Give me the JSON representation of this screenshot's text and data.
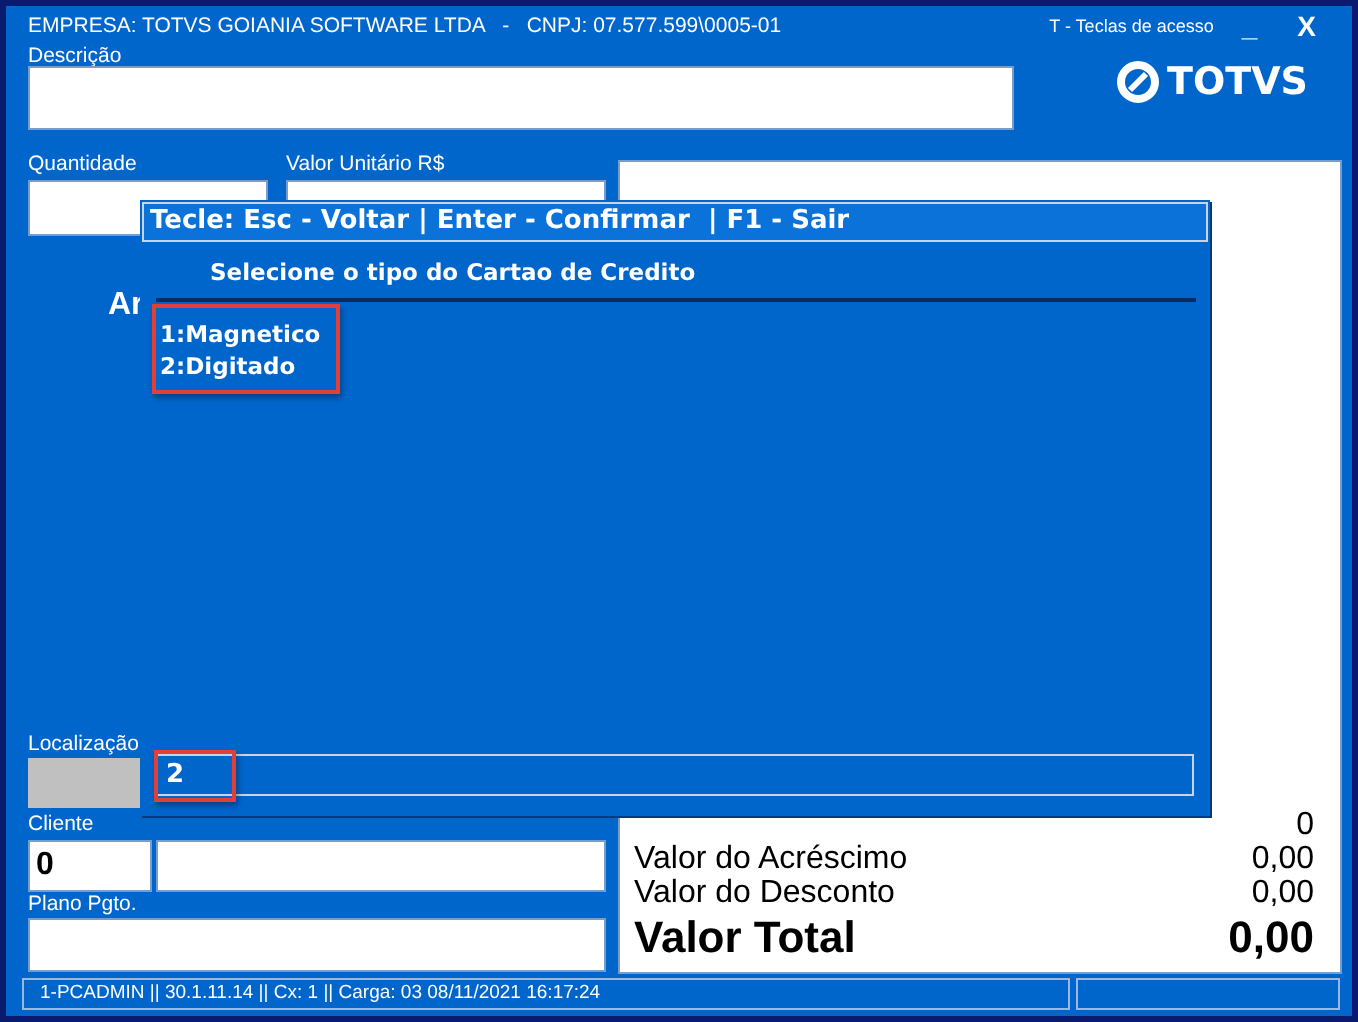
{
  "header": {
    "company": "EMPRESA: TOTVS GOIANIA SOFTWARE LTDA   -   CNPJ: 07.577.599\\0005-01",
    "shortcut_hint": "T - Teclas de acesso",
    "minimize": "_",
    "close": "X"
  },
  "logo": {
    "text": "TOTVS"
  },
  "fields": {
    "descricao": {
      "label": "Descrição"
    },
    "quantidade": {
      "label": "Quantidade"
    },
    "valor_unitario": {
      "label": "Valor Unitário R$"
    },
    "localizacao": {
      "label": "Localização"
    },
    "cliente": {
      "label": "Cliente",
      "value": "0"
    },
    "plano_pgto": {
      "label": "Plano Pgto."
    }
  },
  "product_text": "Ar",
  "totals": [
    {
      "value": "0",
      "kind": "normal"
    },
    {
      "label": "Valor do Acréscimo",
      "value": "0,00",
      "kind": "normal"
    },
    {
      "label": "Valor do Desconto",
      "value": "0,00",
      "kind": "normal"
    },
    {
      "label": "Valor Total",
      "value": "0,00",
      "kind": "grand"
    }
  ],
  "status_bar": {
    "text": "1-PCADMIN || 30.1.11.14 || Cx: 1 || Carga: 03 08/11/2021 16:17:24"
  },
  "dialog": {
    "title": "Tecle: Esc - Voltar | Enter - Confirmar  | F1 - Sair",
    "heading": "Selecione o tipo do Cartao de Credito",
    "options": [
      "1:Magnetico",
      "2:Digitado"
    ],
    "input": {
      "value": "2"
    }
  }
}
